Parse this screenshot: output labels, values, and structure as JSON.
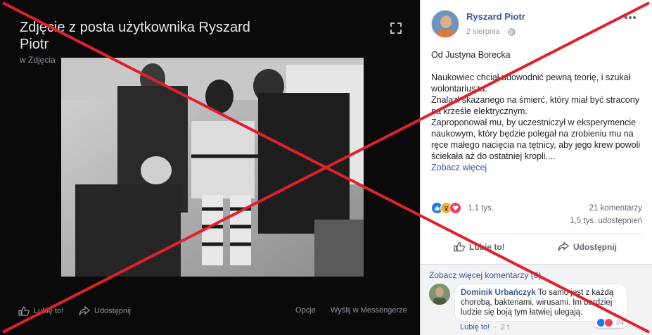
{
  "theater": {
    "title": "Zdjęcie z posta użytkownika Ryszard Piotr",
    "subtitle": "w Zdjęcia",
    "bar": {
      "like": "Lubię to!",
      "share": "Udostępnij",
      "options": "Opcje",
      "messenger": "Wyślij w Messengerze"
    }
  },
  "post": {
    "author": "Ryszard Piotr",
    "date": "2 sierpnia",
    "date_sep": "·",
    "privacy_icon": "globe-icon",
    "lines": [
      "Od Justyna Borecka",
      "",
      "Naukowiec chciał udowodnić pewną teorię, i szukał wolontariusza.",
      "Znalazł skazanego na śmierć, który miał być stracony na krześle elektrycznym.",
      "Zaproponował mu, by uczestniczył w eksperymencie naukowym, który będzie polegał na zrobieniu mu na ręce małego nacięcia na tętnicy, aby jego krew powoli ściekała aż do ostatniej kropli...."
    ],
    "see_more": "Zobacz więcej",
    "reactions_count": "1,1 tys.",
    "comments_count": "21 komentarzy",
    "shares_count": "1,5 tys. udostępnień",
    "like_label": "Lubię to!",
    "share_label": "Udostępnij"
  },
  "comments": {
    "see_more": "Zobacz więcej komentarzy (8)",
    "items": [
      {
        "name": "Dominik Urbańczyk",
        "text": "To samo jest z każdą chorobą, bakteriami, wirusami. Im bardziej ludzie się boją tym łatwiej ulegają.",
        "like": "Lubię to!",
        "sep": "·",
        "time": "2 t",
        "reactions": "24"
      }
    ]
  },
  "colors": {
    "link": "#385898",
    "cross": "#e0202a",
    "like_blue": "#1877f2",
    "love_red": "#f33e58",
    "wow_yellow": "#f7b125"
  }
}
